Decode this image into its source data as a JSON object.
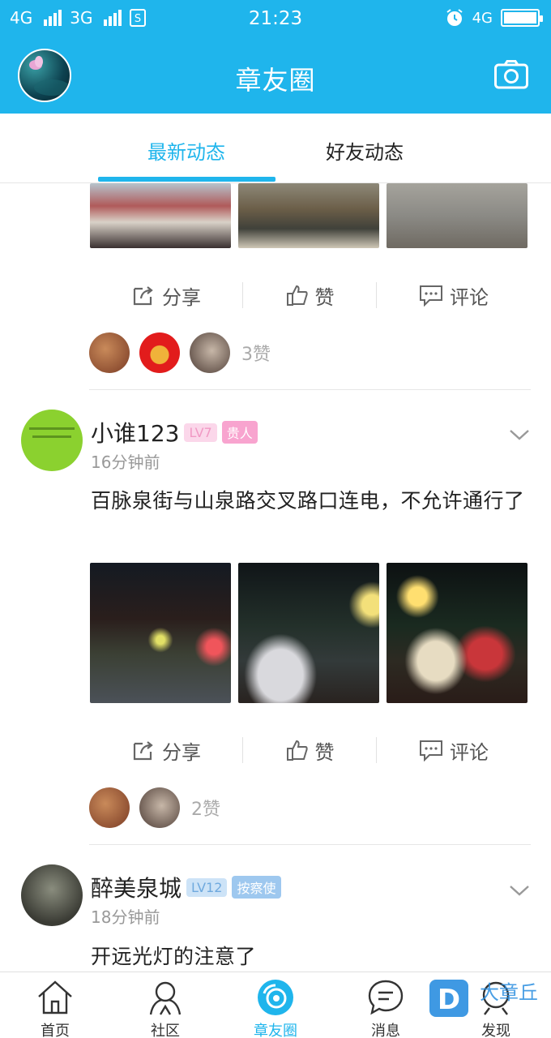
{
  "status_bar": {
    "network1": "4G",
    "network2": "3G",
    "sim_icon": "sim-s-icon",
    "time": "21:23",
    "network_right": "4G",
    "battery_level": 1.0
  },
  "header": {
    "title": "章友圈"
  },
  "tabs": {
    "latest": "最新动态",
    "friends": "好友动态"
  },
  "actions": {
    "share": "分享",
    "like": "赞",
    "comment": "评论"
  },
  "posts": [
    {
      "like_count": "3赞"
    },
    {
      "username": "小谁123",
      "level": "LV7",
      "title": "贵人",
      "time": "16分钟前",
      "text": "百脉泉街与山泉路交叉路口连电，不允许通行了",
      "like_count": "2赞"
    },
    {
      "username": "醉美泉城",
      "level": "LV12",
      "title": "按察使",
      "time": "18分钟前",
      "text": "开远光灯的注意了"
    }
  ],
  "bottom_nav": {
    "home": "首页",
    "community": "社区",
    "circle": "章友圈",
    "messages": "消息",
    "discover": "发现"
  },
  "watermark": {
    "text": "大章丘",
    "logo_letter": "D"
  },
  "colors": {
    "accent": "#1fb5ec"
  }
}
